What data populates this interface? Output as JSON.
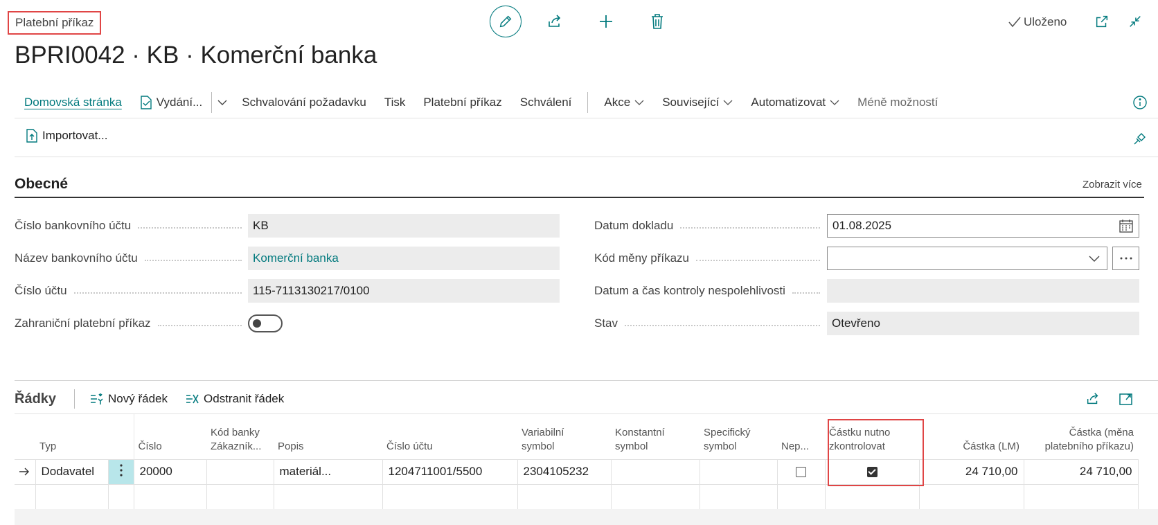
{
  "header": {
    "breadcrumb": "Platební příkaz",
    "title": "BPRI0042 · KB · Komerční banka",
    "saved_label": "Uloženo",
    "icons": [
      "edit-icon",
      "share-icon",
      "add-icon",
      "delete-icon",
      "open-new-window-icon",
      "collapse-icon"
    ]
  },
  "actionbar": {
    "items": {
      "home": "Domovská stránka",
      "release": "Vydání...",
      "approval_request": "Schvalování požadavku",
      "print": "Tisk",
      "payment_order": "Platební příkaz",
      "approval": "Schválení",
      "actions": "Akce",
      "related": "Související",
      "automate": "Automatizovat",
      "fewer_options": "Méně možností"
    },
    "import_label": "Importovat..."
  },
  "general": {
    "title": "Obecné",
    "show_more": "Zobrazit více",
    "left": {
      "bank_account_no_label": "Číslo bankovního účtu",
      "bank_account_no": "KB",
      "bank_account_name_label": "Název bankovního účtu",
      "bank_account_name": "Komerční banka",
      "account_no_label": "Číslo účtu",
      "account_no": "115-7113130217/0100",
      "foreign_label": "Zahraniční platební příkaz",
      "foreign_value": false
    },
    "right": {
      "document_date_label": "Datum dokladu",
      "document_date": "01.08.2025",
      "currency_label": "Kód měny příkazu",
      "currency_value": "",
      "unreliability_label": "Datum a čas kontroly nespolehlivosti",
      "unreliability_value": "",
      "status_label": "Stav",
      "status_value": "Otevřeno"
    }
  },
  "lines": {
    "title": "Řádky",
    "new_line": "Nový řádek",
    "delete_line": "Odstranit řádek",
    "columns": {
      "type": "Typ",
      "no": "Číslo",
      "bank_code_1": "Kód banky",
      "bank_code_2": "Zákazník...",
      "description": "Popis",
      "account_no": "Číslo účtu",
      "variable_1": "Variabilní",
      "variable_2": "symbol",
      "constant_1": "Konstantní",
      "constant_2": "symbol",
      "specific_1": "Specifický",
      "specific_2": "symbol",
      "nep": "Nep...",
      "check_1": "Částku nutno",
      "check_2": "zkontrolovat",
      "amount_lcy": "Částka (LM)",
      "amount_fcy_1": "Částka (měna",
      "amount_fcy_2": "platebního příkazu)"
    },
    "rows": [
      {
        "type": "Dodavatel",
        "no": "20000",
        "bank_code": "",
        "description": "materiál...",
        "account_no": "1204711001/5500",
        "variable_symbol": "2304105232",
        "constant_symbol": "",
        "specific_symbol": "",
        "nep": false,
        "amount_must_be_checked": true,
        "amount_lcy": "24 710,00",
        "amount_fcy": "24 710,00"
      }
    ]
  },
  "colors": {
    "accent": "#00797d",
    "highlight": "#e04545",
    "selected_cell": "#b8e6ea"
  }
}
